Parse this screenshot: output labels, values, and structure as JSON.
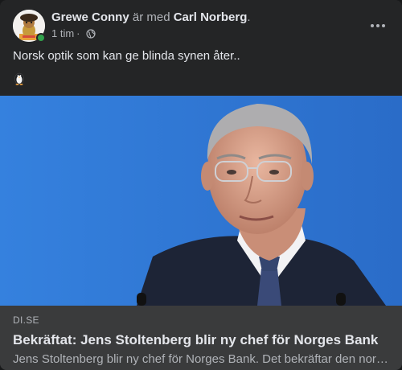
{
  "post": {
    "author": "Grewe Conny",
    "with_text": "är med",
    "tagged": "Carl Norberg",
    "period": ".",
    "time": "1 tim",
    "separator": "·",
    "privacy_icon": "globe-icon",
    "more_icon": "more-dots-icon",
    "text": "Norsk optik som kan ge blinda synen åter..",
    "emoji_icon": "penguin-emoji"
  },
  "link": {
    "domain": "DI.SE",
    "title": "Bekräftat: Jens Stoltenberg blir ny chef för Norges Bank",
    "description": "Jens Stoltenberg blir ny chef för Norges Bank. Det bekräftar den norska regeringen."
  },
  "colors": {
    "card_bg": "#242526",
    "link_info_bg": "#3a3b3c",
    "primary_text": "#e4e6eb",
    "secondary_text": "#b0b3b8",
    "online": "#31a24c",
    "photo_bg": "#2e73d1"
  }
}
